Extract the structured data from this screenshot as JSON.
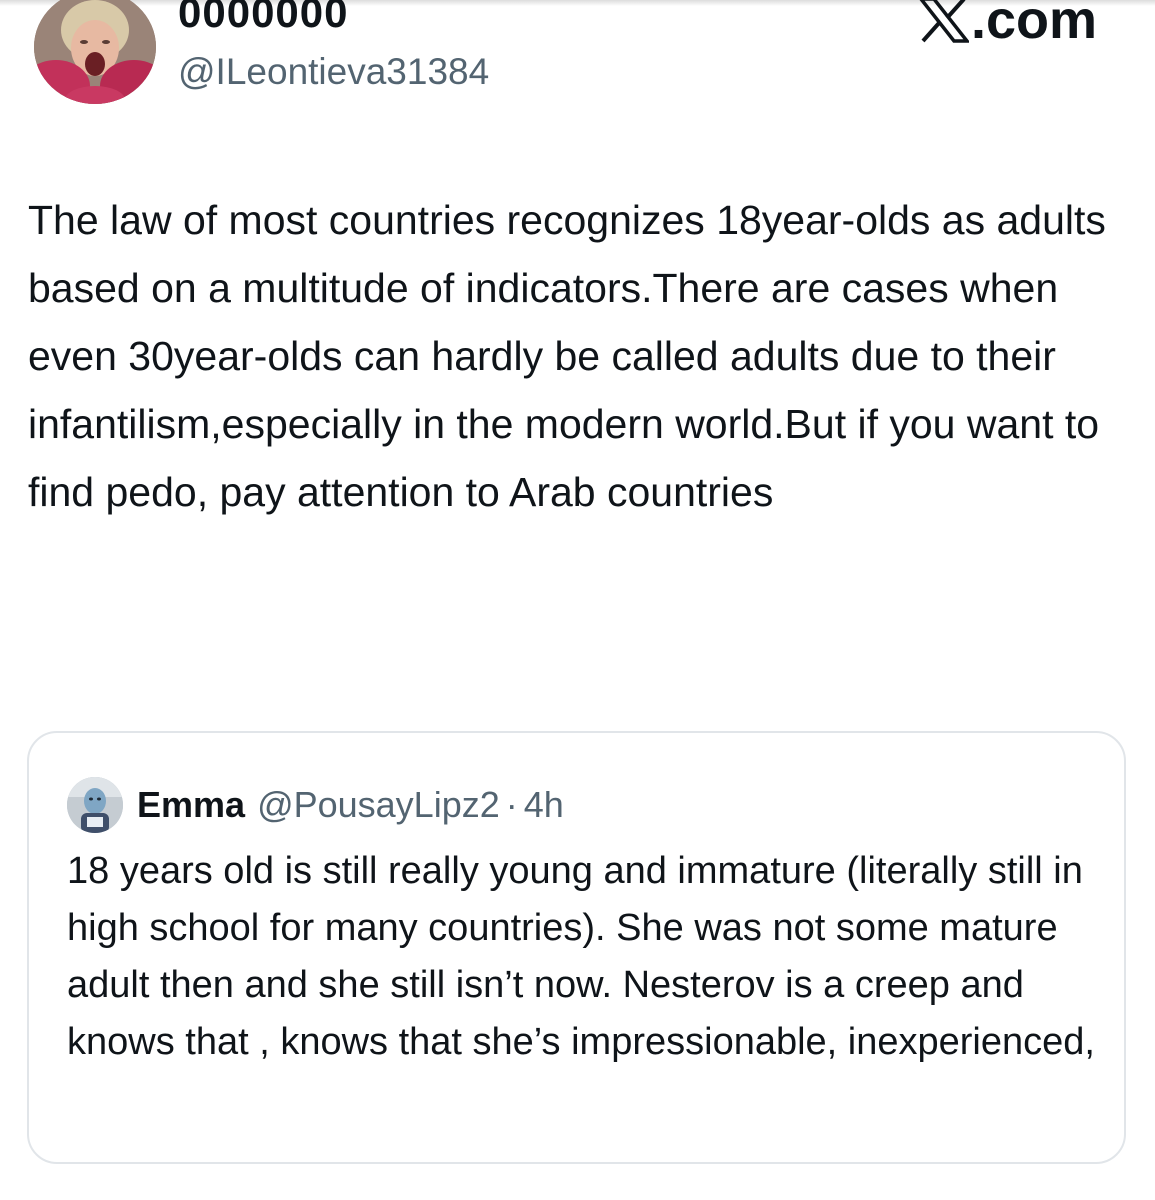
{
  "tweet": {
    "display_name": "0000000",
    "handle": "@ILeontieva31384",
    "avatar_icon": "profile-avatar-icon",
    "text": "The law of most countries recognizes 18year-olds as adults based on a multitude of indicators.There are cases when even 30year-olds can hardly be called adults due to their infantilism,especially in the modern world.But if you want to find pedo, pay attention to Arab countries"
  },
  "brand": {
    "icon": "x-logo-icon",
    "suffix": ".com"
  },
  "quoted_tweet": {
    "display_name": "Emma",
    "handle": "@PousayLipz2",
    "separator": "·",
    "time": "4h",
    "avatar_icon": "quoted-avatar-icon",
    "text": "18 years old is still really young and immature (literally still in high school for many countries). She was not some mature adult then and she still isn’t now. Nesterov is a creep and knows that , knows that she’s impressionable, inexperienced,"
  },
  "colors": {
    "text": "#0f1419",
    "secondary_text": "#536471",
    "border": "#e1e5e9",
    "background": "#ffffff"
  }
}
